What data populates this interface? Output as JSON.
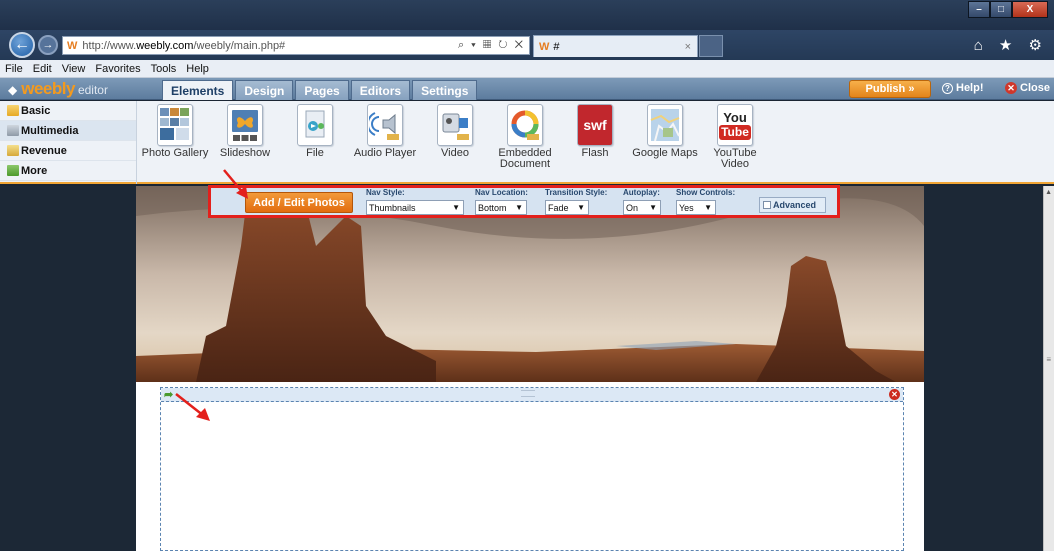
{
  "browser": {
    "url_prefix": "http://www.",
    "url_domain": "weebly.com",
    "url_path": "/weebly/main.php#",
    "url_tools": "⌕ ▾ ▦ ↻ ✕",
    "tab_title": "#",
    "tab_close": "×",
    "favicon": "W",
    "back_icon": "←",
    "forward_icon": "→",
    "tool_icons": "⌂ ★ ⚙",
    "win_min": "–",
    "win_max": "□",
    "win_close": "X"
  },
  "menubar": [
    "File",
    "Edit",
    "View",
    "Favorites",
    "Tools",
    "Help"
  ],
  "editor": {
    "logo_word": "weebly",
    "logo_sub": "editor",
    "tabs": [
      "Elements",
      "Design",
      "Pages",
      "Editors",
      "Settings"
    ],
    "publish_label": "Publish »",
    "help_label": "Help!",
    "close_label": "Close"
  },
  "categories": [
    "Basic",
    "Multimedia",
    "Revenue",
    "More"
  ],
  "elements": [
    {
      "label": "Photo Gallery",
      "icon": "gallery-icon"
    },
    {
      "label": "Slideshow",
      "icon": "slideshow-icon"
    },
    {
      "label": "File",
      "icon": "file-icon"
    },
    {
      "label": "Audio Player",
      "icon": "audio-icon"
    },
    {
      "label": "Video",
      "icon": "video-icon"
    },
    {
      "label": "Embedded Document",
      "icon": "document-icon"
    },
    {
      "label": "Flash",
      "icon": "flash-icon"
    },
    {
      "label": "Google Maps",
      "icon": "map-icon"
    },
    {
      "label": "YouTube Video",
      "icon": "youtube-icon"
    }
  ],
  "icon_text": {
    "swf": "swf",
    "you": "You",
    "tube": "Tube"
  },
  "gallery_toolbar": {
    "add_edit_label": "Add / Edit Photos",
    "nav_style_label": "Nav Style:",
    "nav_style_value": "Thumbnails",
    "nav_location_label": "Nav Location:",
    "nav_location_value": "Bottom",
    "transition_label": "Transition Style:",
    "transition_value": "Fade",
    "autoplay_label": "Autoplay:",
    "autoplay_value": "On",
    "show_controls_label": "Show Controls:",
    "show_controls_value": "Yes",
    "advanced_label": "Advanced"
  },
  "colors": {
    "accent_orange": "#e3841a",
    "highlight_red": "#e3201c",
    "header_blue": "#5d7c9e"
  }
}
